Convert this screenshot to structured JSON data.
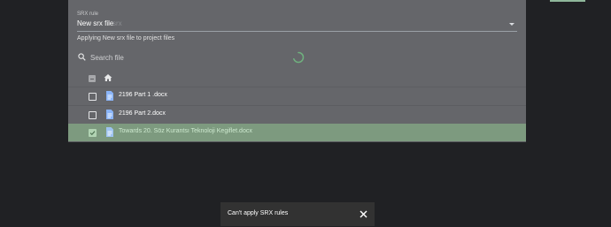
{
  "dialog": {
    "srx_label": "SRX rule",
    "srx_value": "New srx file",
    "srx_faded": "srx",
    "applying_text": "Applying New srx file to project files"
  },
  "search": {
    "placeholder": "Search file",
    "value": ""
  },
  "files": [
    {
      "name": "2196 Part 1 .docx",
      "checked": false,
      "selected": false
    },
    {
      "name": "2196 Part 2.docx",
      "checked": false,
      "selected": false
    },
    {
      "name": "Towards 20. Söz Kurantsı Teknoloji Kegiflet.docx",
      "checked": true,
      "selected": true
    }
  ],
  "snackbar": {
    "message": "Can't apply SRX rules",
    "close_icon": "close-icon"
  },
  "colors": {
    "dialog_bg": "#65666a",
    "page_bg": "#202124",
    "accent_green": "#8fb79b",
    "selected_row": "#7d9a7f",
    "snackbar_bg": "#323232"
  }
}
